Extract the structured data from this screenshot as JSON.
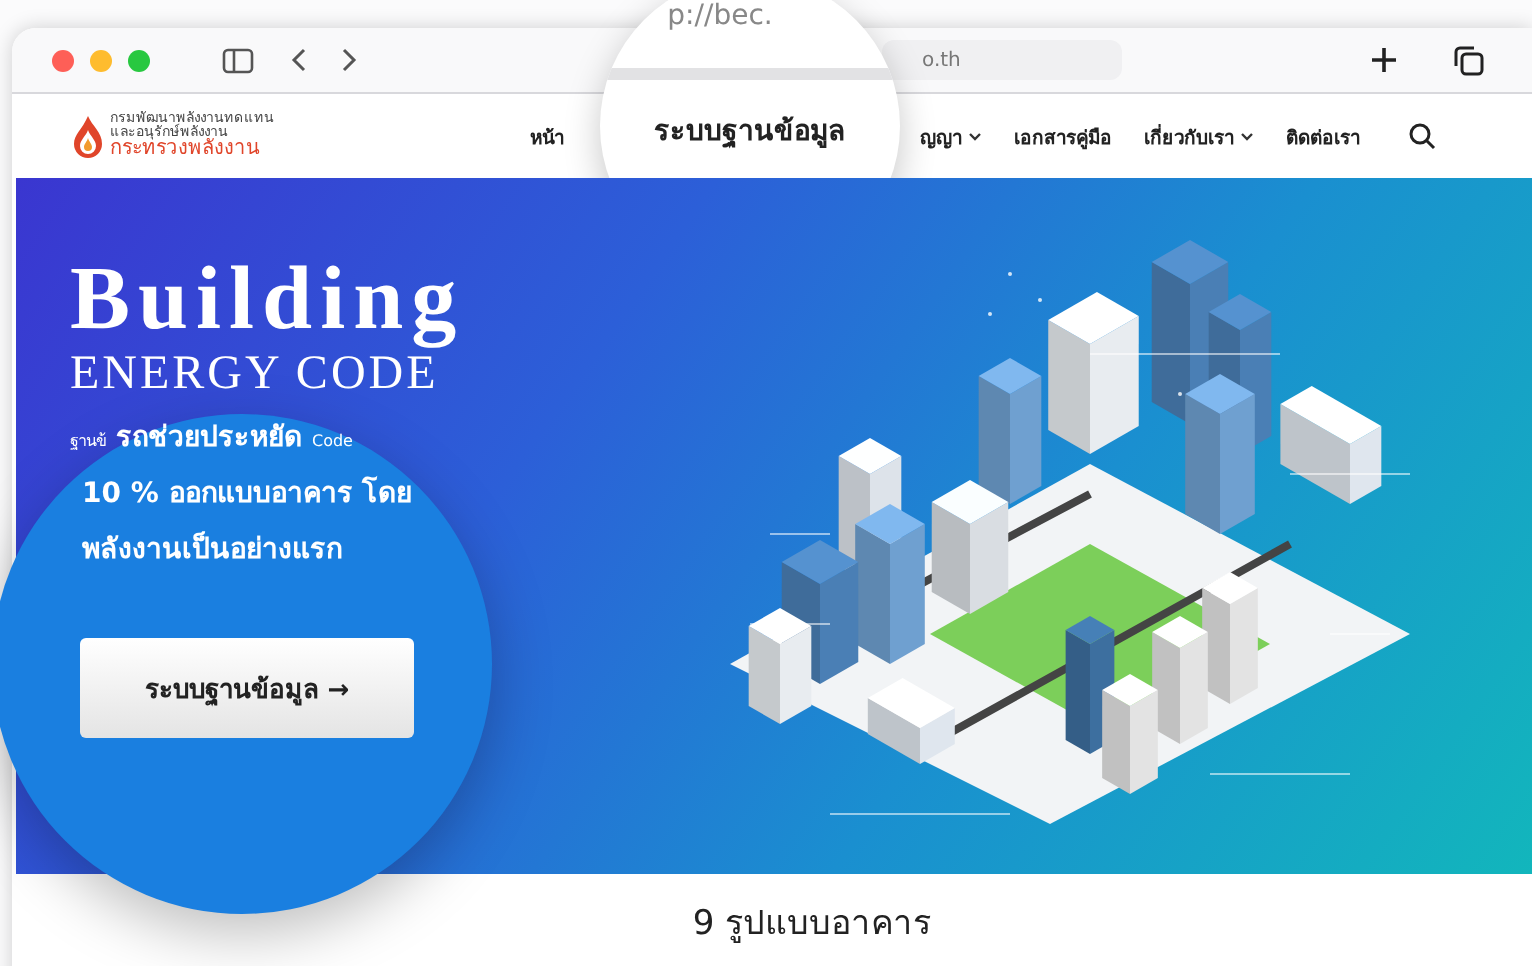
{
  "browser": {
    "address_partial": "o.th"
  },
  "site_header": {
    "logo_lines": [
      "กรมพัฒนาพลังงานทดแทน",
      "และอนุรักษ์พลังงาน",
      "กระทรวงพลังงาน"
    ],
    "nav": [
      {
        "label": "หน้า",
        "dropdown": false
      },
      {
        "label": "ญญา",
        "dropdown": true
      },
      {
        "label": "เอกสารคู่มือ",
        "dropdown": false
      },
      {
        "label": "เกี่ยวกับเรา",
        "dropdown": true
      },
      {
        "label": "ติดต่อเรา",
        "dropdown": false
      }
    ]
  },
  "magnifier_top": {
    "address": "p://bec.",
    "nav_item": "ระบบฐานข้อมูล"
  },
  "hero": {
    "title": "Building",
    "subtitle": "ENERGY CODE",
    "description_fragments": [
      "ฐานข้",
      "รถช่วยประหยัด",
      "Code"
    ],
    "description_lines": [
      "10 % ออกแบบอาคาร โดย",
      "พลังงานเป็นอย่างแรก"
    ],
    "button": "ระบบฐานข้อมูล →"
  },
  "section": {
    "heading": "9 รูปแบบอาคาร"
  }
}
